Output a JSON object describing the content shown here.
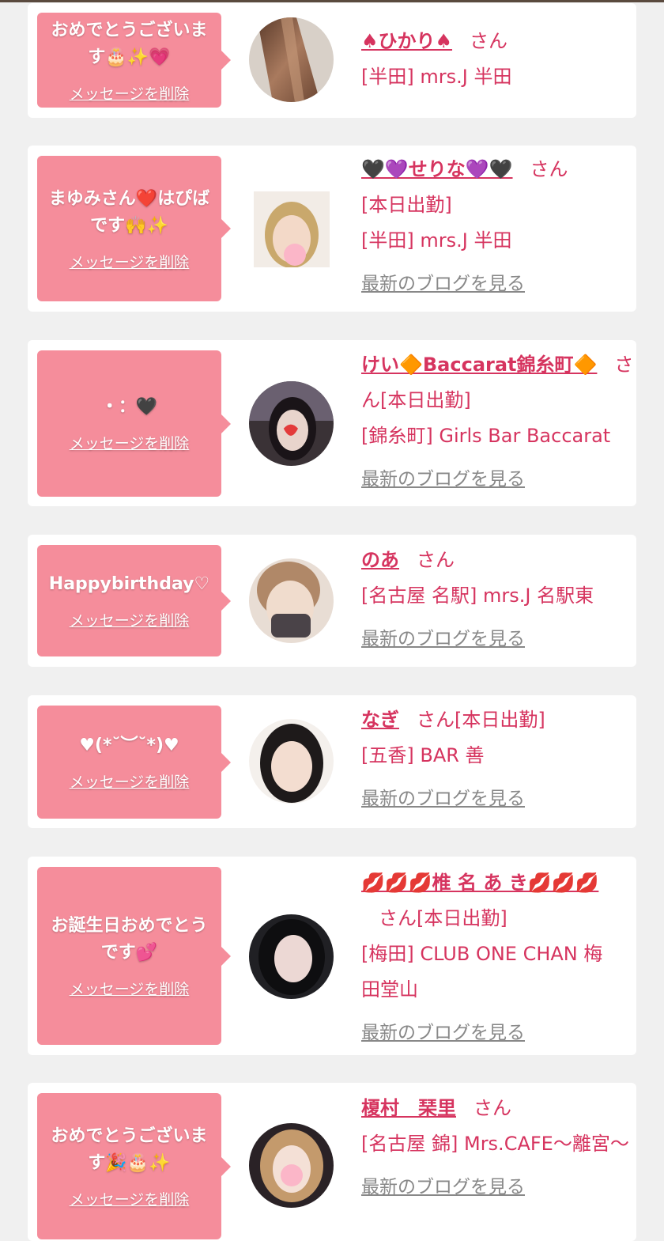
{
  "colors": {
    "accent": "#d6345f",
    "bubble": "#f58d9b",
    "blog_link": "#888888",
    "background": "#f0f0f0"
  },
  "delete_label": "メッセージを削除",
  "blog_label": "最新のブログを見る",
  "san_label": "さん",
  "cards": [
    {
      "message": "おめでとうございます🎂✨💗",
      "name": "♠ひかり♠",
      "today": "",
      "shop": "[半田] mrs.J 半田",
      "has_blog": false
    },
    {
      "message": "まゆみさん❤️はぴばです🙌✨",
      "name": "🖤💜せりな💜🖤",
      "today": "[本日出勤]",
      "shop": "[半田] mrs.J 半田",
      "has_blog": true
    },
    {
      "message": "・：🖤",
      "name": "けい🔶Baccarat錦糸町🔶",
      "today": "[本日出勤]",
      "shop": "[錦糸町] Girls Bar Baccarat",
      "has_blog": true
    },
    {
      "message": "Happybirthday♡",
      "name": "のあ",
      "today": "",
      "shop": "[名古屋 名駅] mrs.J 名駅東",
      "has_blog": true
    },
    {
      "message": "♥︎(*˘︶˘*)♥︎",
      "name": "なぎ",
      "today": "[本日出勤]",
      "shop": "[五香] BAR 善",
      "has_blog": true
    },
    {
      "message": "お誕生日おめでとうです💕",
      "name": "💋💋💋椎 名 あ き💋💋💋",
      "today": "[本日出勤]",
      "shop": "[梅田] CLUB ONE CHAN 梅田堂山",
      "has_blog": true
    },
    {
      "message": "おめでとうございます🎉🎂✨",
      "name": "榎村　琹里",
      "today": "",
      "shop": "[名古屋 錦] Mrs.CAFE～離宮～",
      "has_blog": true
    }
  ]
}
